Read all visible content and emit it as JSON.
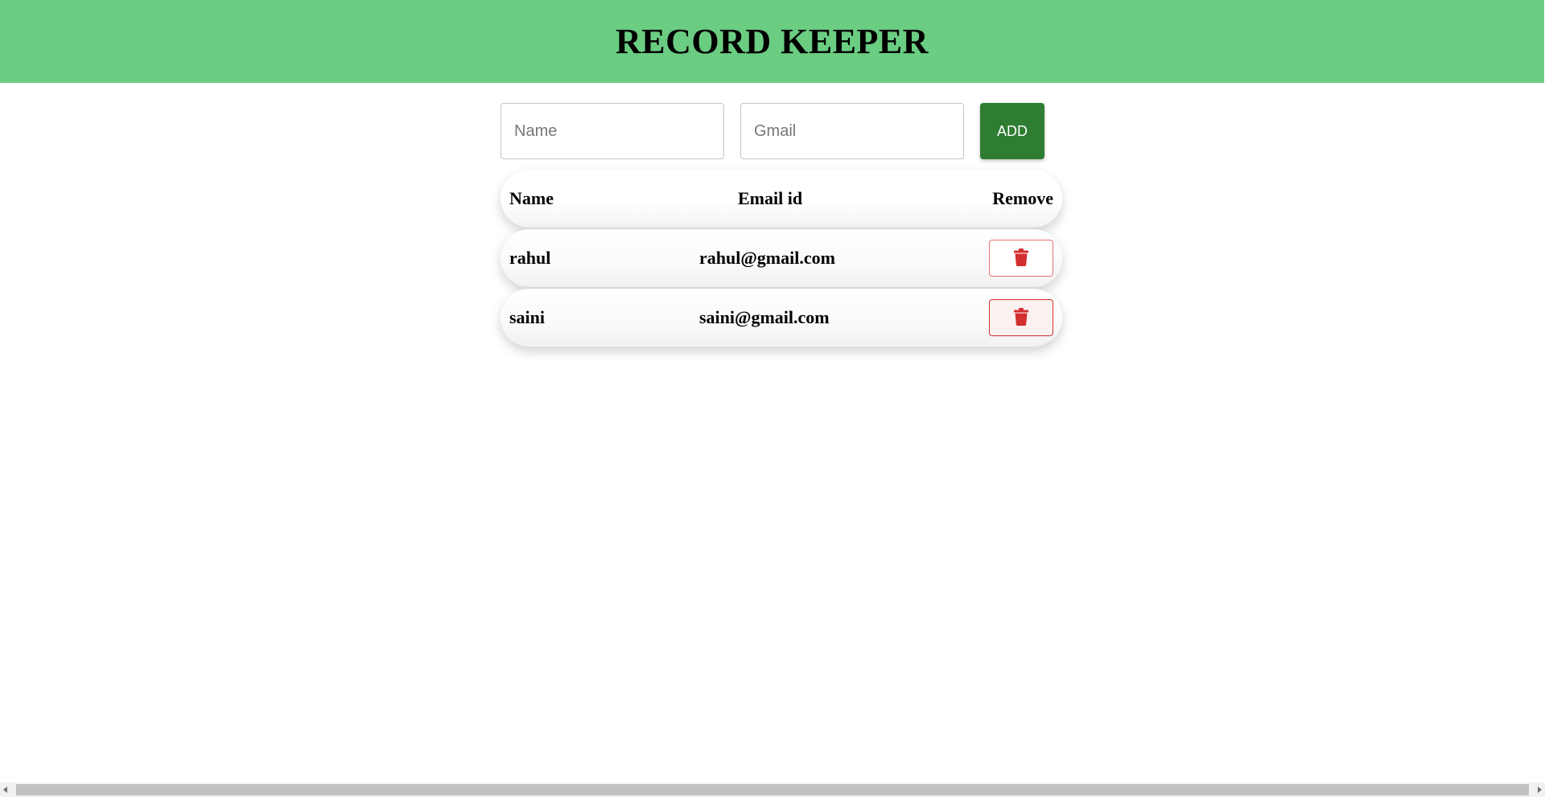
{
  "app": {
    "title": "RECORD KEEPER"
  },
  "form": {
    "name_placeholder": "Name",
    "name_value": "",
    "gmail_placeholder": "Gmail",
    "gmail_value": "",
    "add_label": "ADD"
  },
  "table": {
    "headers": {
      "name": "Name",
      "email": "Email id",
      "remove": "Remove"
    },
    "rows": [
      {
        "name": "rahul",
        "email": "rahul@gmail.com",
        "remove_icon": "trash-icon"
      },
      {
        "name": "saini",
        "email": "saini@gmail.com",
        "remove_icon": "trash-icon"
      }
    ]
  },
  "colors": {
    "header_bg": "#6acd82",
    "add_button_bg": "#2e7d32",
    "delete_icon": "#d32f2f",
    "delete_border": "#e57373"
  },
  "icons": {
    "delete": "trash-icon",
    "scroll_left": "scroll-left-arrow-icon",
    "scroll_right": "scroll-right-arrow-icon"
  }
}
